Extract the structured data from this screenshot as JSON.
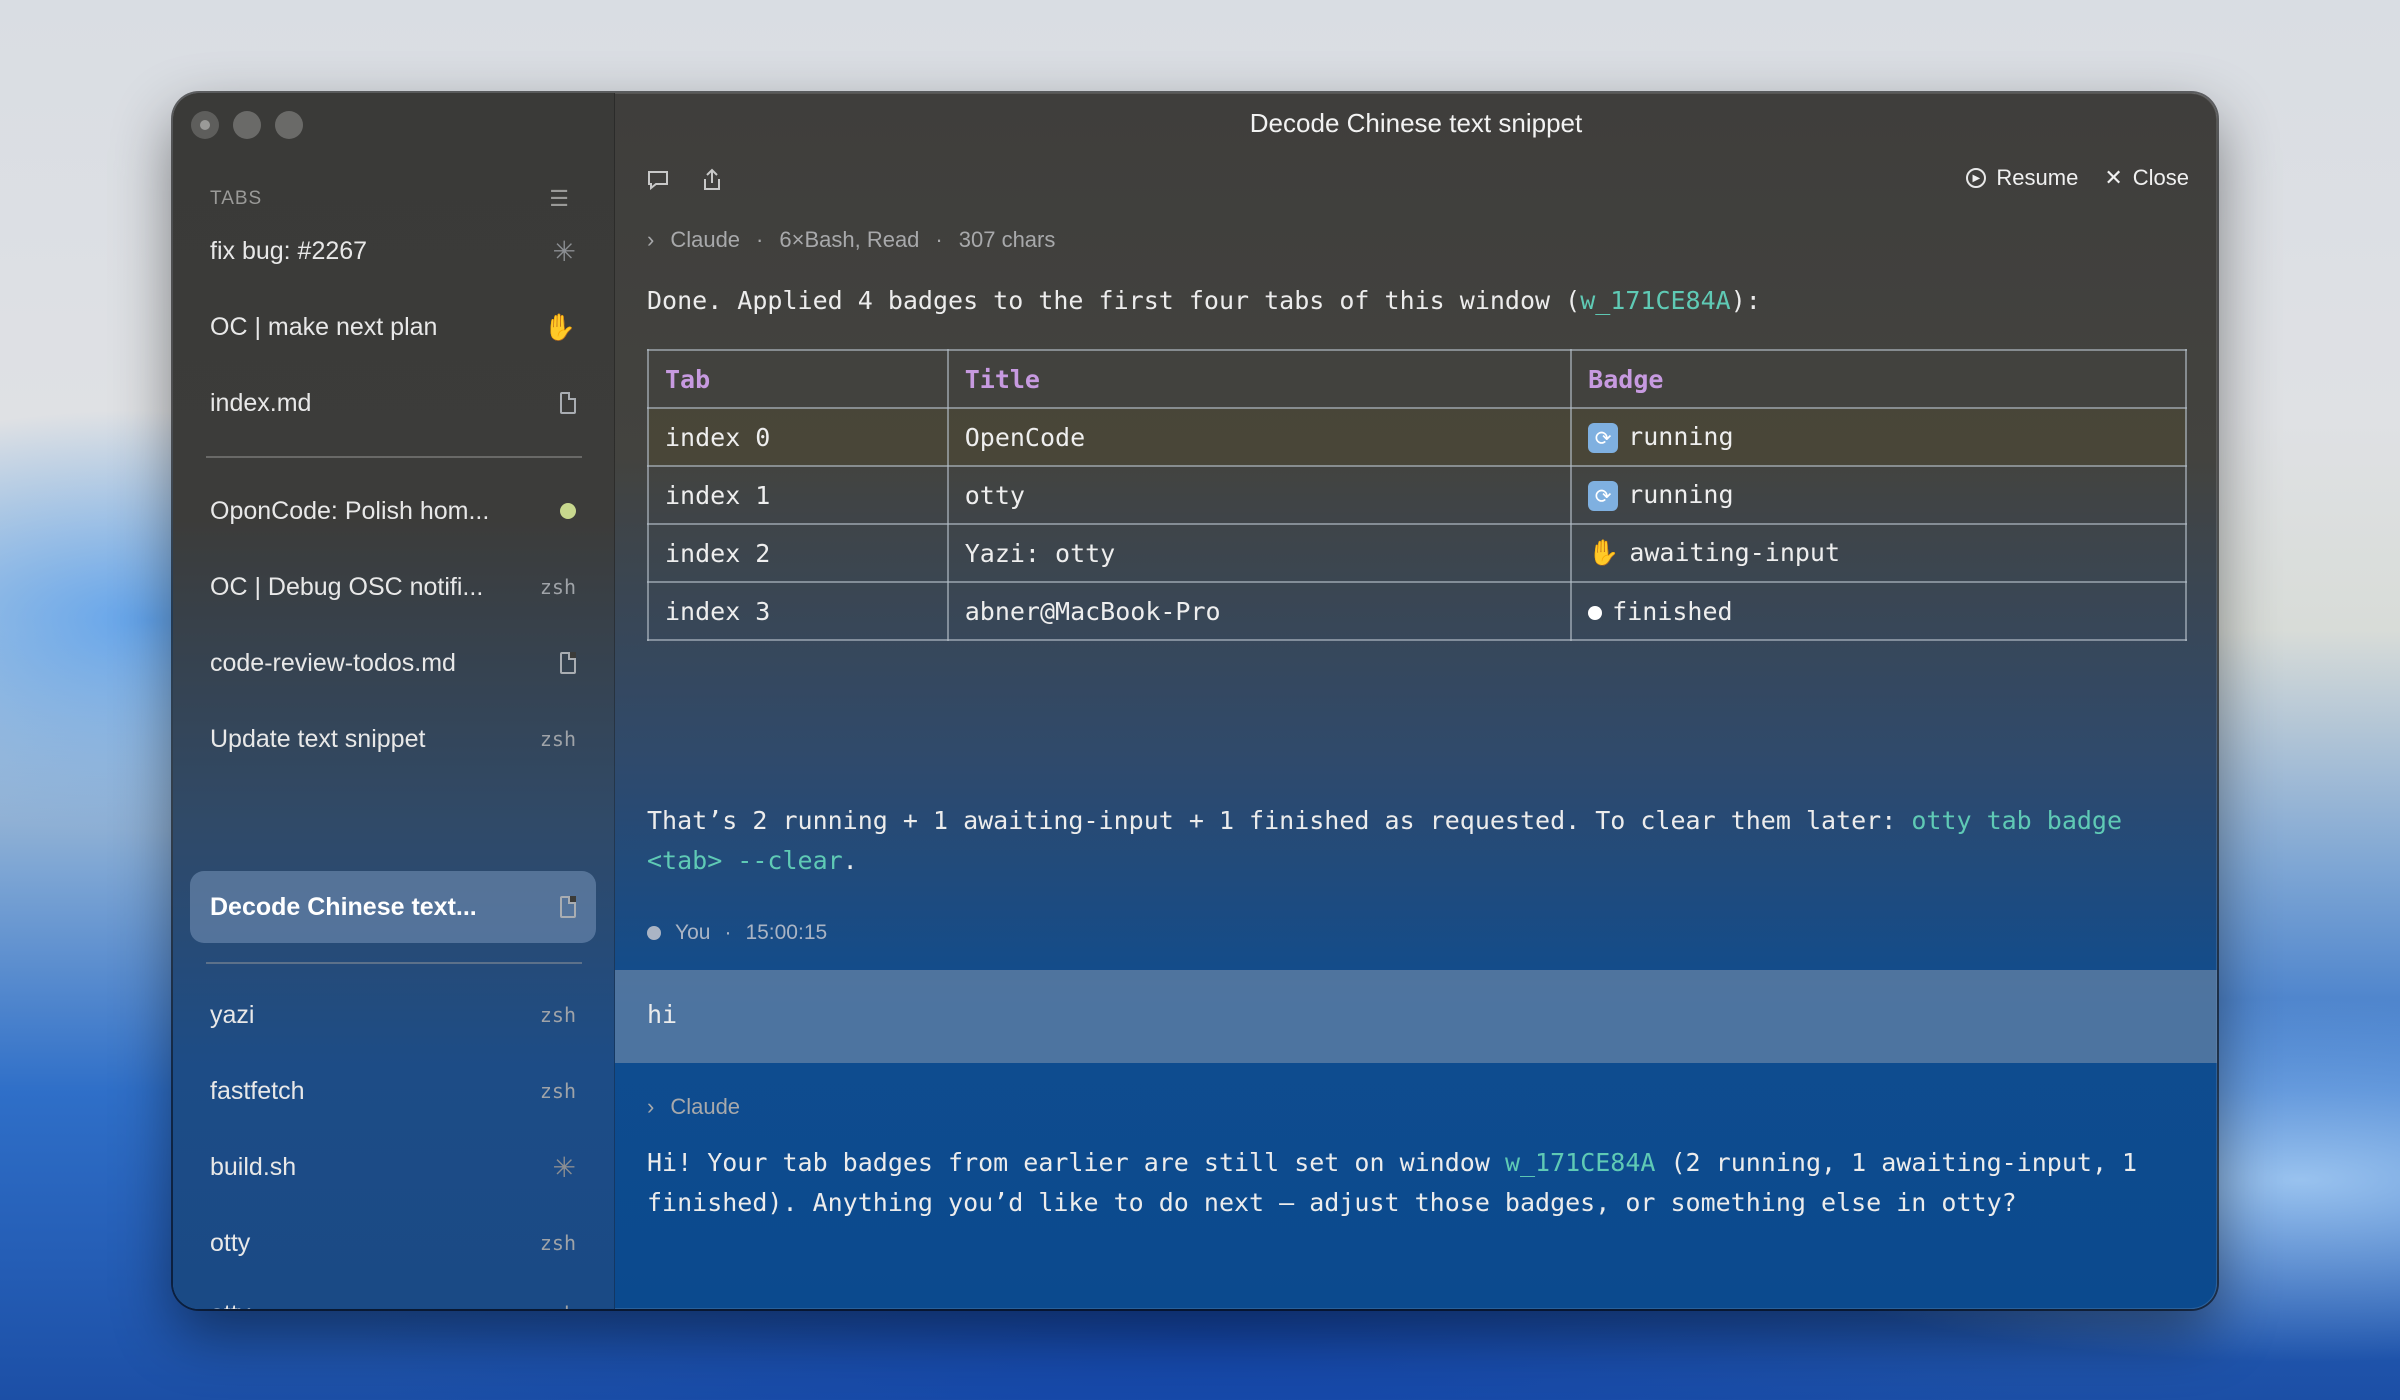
{
  "window": {
    "title": "Decode Chinese text snippet"
  },
  "sidebar": {
    "header": "TABS",
    "items": [
      {
        "label": "fix bug: #2267",
        "indicator": "spinner"
      },
      {
        "label": "OC | make next plan",
        "indicator": "hand"
      },
      {
        "label": "index.md",
        "indicator": "document"
      },
      {
        "label": "OponCode: Polish hom...",
        "indicator": "green-dot"
      },
      {
        "label": "OC | Debug OSC notifi...",
        "meta": "zsh"
      },
      {
        "label": "code-review-todos.md",
        "indicator": "document"
      },
      {
        "label": "Update text snippet",
        "meta": "zsh"
      },
      {
        "label": "Decode Chinese text...",
        "indicator": "document",
        "active": true
      },
      {
        "label": "yazi",
        "meta": "zsh"
      },
      {
        "label": "fastfetch",
        "meta": "zsh"
      },
      {
        "label": "build.sh",
        "indicator": "spinner"
      },
      {
        "label": "otty",
        "meta": "zsh"
      },
      {
        "label": "otty",
        "meta": "zsh"
      }
    ]
  },
  "toolbar": {
    "resume_label": "Resume",
    "close_label": "Close",
    "icons": [
      "comment-icon",
      "share-icon"
    ]
  },
  "conversation": {
    "claude_meta_1": {
      "name": "Claude",
      "tools": "6×Bash, Read",
      "chars": "307 chars"
    },
    "message1_prefix": "Done. Applied 4 badges to the first four tabs of this window (",
    "message1_window_id": "w_171CE84A",
    "message1_suffix": "):",
    "table": {
      "headers": [
        "Tab",
        "Title",
        "Badge"
      ],
      "rows": [
        {
          "tab": "index 0",
          "title": "OpenCode",
          "badge": "running",
          "badge_icon": "🔄"
        },
        {
          "tab": "index 1",
          "title": "otty",
          "badge": "running",
          "badge_icon": "🔄"
        },
        {
          "tab": "index 2",
          "title": "Yazi: otty",
          "badge": "awaiting-input",
          "badge_icon": "✋"
        },
        {
          "tab": "index 3",
          "title": "abner@MacBook-Pro",
          "badge": "finished",
          "badge_icon": "●"
        }
      ]
    },
    "message2_prefix": "That’s 2 running + 1 awaiting-input + 1 finished as requested. To clear them later: ",
    "message2_command": "otty tab badge <tab> --clear",
    "message2_suffix": ".",
    "user_meta": {
      "name": "You",
      "time": "15:00:15"
    },
    "user_message": "hi",
    "claude_meta_2": {
      "name": "Claude"
    },
    "message3_prefix": "Hi! Your tab badges from earlier are still set on window ",
    "message3_window_id": "w_171CE84A",
    "message3_suffix": " (2 running, 1 awaiting-input, 1 finished). Anything you’d like to do next — adjust those badges, or something else in otty?"
  },
  "colors": {
    "accent_link": "#5fcab5",
    "table_header": "#c79ae0",
    "hand_indicator": "#e08a3c",
    "active_tab": "#7896b9"
  }
}
